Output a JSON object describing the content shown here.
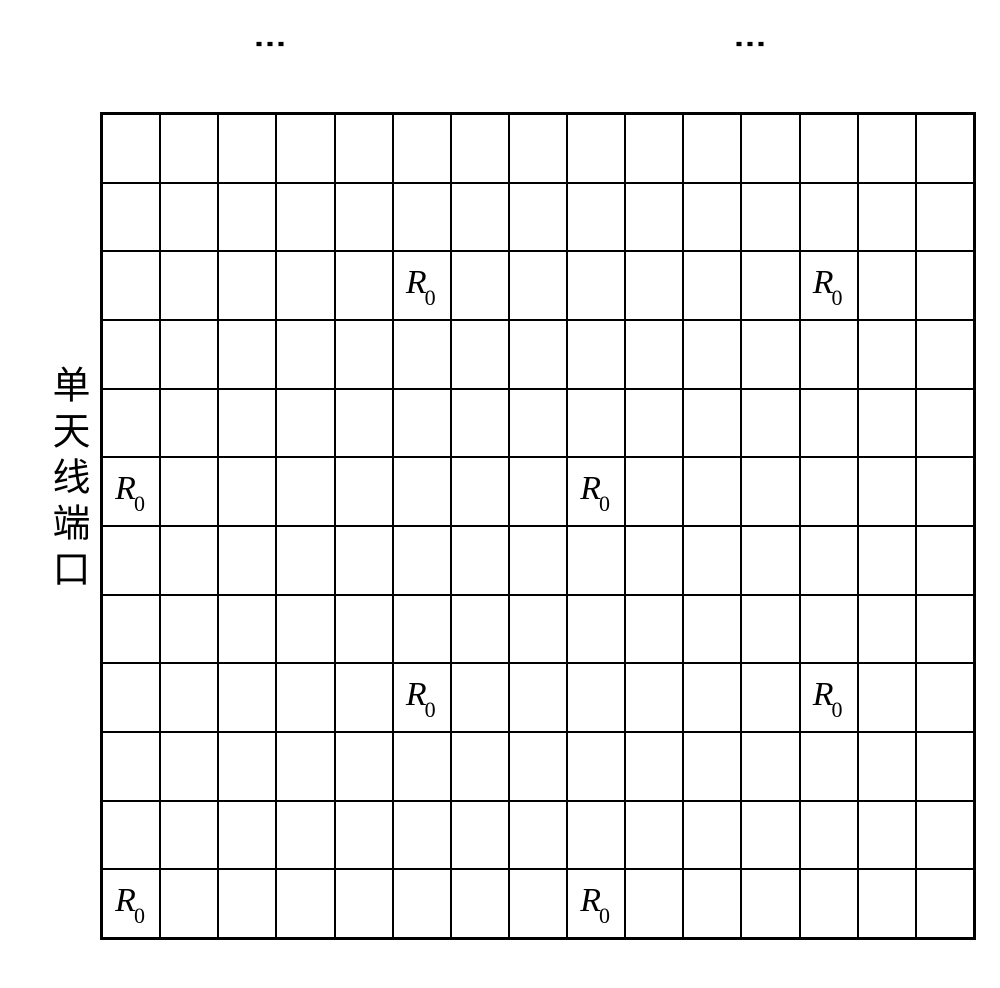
{
  "vertical_label": "单天线端口",
  "dots": "⋮",
  "symbol_base": "R",
  "symbol_sub": "0",
  "grid": {
    "rows": 12,
    "cols": 15,
    "symbol_positions": [
      {
        "row": 2,
        "col": 5
      },
      {
        "row": 2,
        "col": 12
      },
      {
        "row": 5,
        "col": 0
      },
      {
        "row": 5,
        "col": 8
      },
      {
        "row": 8,
        "col": 5
      },
      {
        "row": 8,
        "col": 12
      },
      {
        "row": 11,
        "col": 0
      },
      {
        "row": 11,
        "col": 8
      }
    ]
  }
}
